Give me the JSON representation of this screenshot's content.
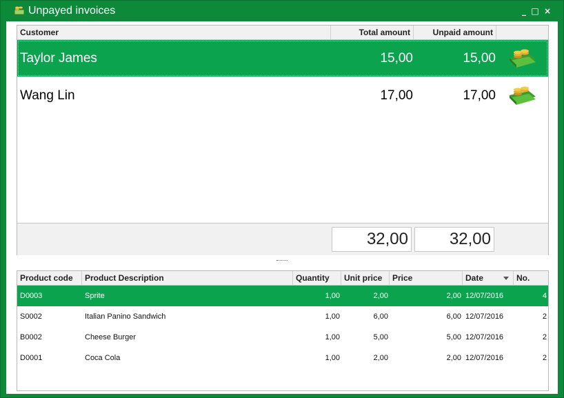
{
  "window": {
    "title": "Unpayed invoices",
    "accent": "#0c8a3a",
    "selection_color": "#0ca34e",
    "title_icon": "money-icon",
    "controls": {
      "minimize": "minimize-icon",
      "maximize": "maximize-icon",
      "close": "close-icon"
    }
  },
  "customers": {
    "columns": [
      "Customer",
      "Total amount",
      "Unpaid amount"
    ],
    "rows": [
      {
        "customer": "Taylor James",
        "total": "15,00",
        "unpaid": "15,00",
        "icon": "money-icon",
        "selected": true
      },
      {
        "customer": "Wang Lin",
        "total": "17,00",
        "unpaid": "17,00",
        "icon": "money-icon",
        "selected": false
      }
    ],
    "totals": {
      "total": "32,00",
      "unpaid": "32,00"
    }
  },
  "products": {
    "columns": [
      "Product code",
      "Product Description",
      "Quantity",
      "Unit price",
      "Price",
      "Date",
      "No."
    ],
    "sort_column": "Date",
    "rows": [
      {
        "code": "D0003",
        "description": "Sprite",
        "quantity": "1,00",
        "unit_price": "2,00",
        "price": "2,00",
        "date": "12/07/2016",
        "no": "4",
        "selected": true
      },
      {
        "code": "S0002",
        "description": "Italian Panino Sandwich",
        "quantity": "1,00",
        "unit_price": "6,00",
        "price": "6,00",
        "date": "12/07/2016",
        "no": "2",
        "selected": false
      },
      {
        "code": "B0002",
        "description": "Cheese Burger",
        "quantity": "1,00",
        "unit_price": "5,00",
        "price": "5,00",
        "date": "12/07/2016",
        "no": "2",
        "selected": false
      },
      {
        "code": "D0001",
        "description": "Coca Cola",
        "quantity": "1,00",
        "unit_price": "2,00",
        "price": "2,00",
        "date": "12/07/2016",
        "no": "2",
        "selected": false
      }
    ]
  }
}
